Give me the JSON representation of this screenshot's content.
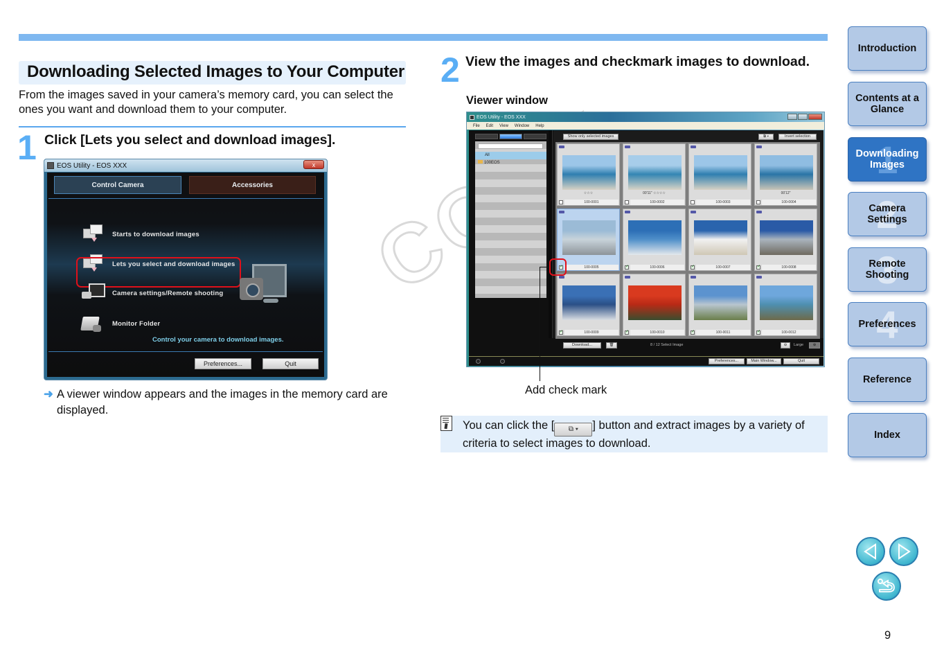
{
  "page": {
    "section_title": "Downloading Selected Images to Your Computer",
    "intro": "From the images saved in your camera’s memory card, you can select the ones you want and download them to your computer.",
    "page_number": "9",
    "watermark": "COPY"
  },
  "step1": {
    "number": "1",
    "title": "Click [Lets you select and download images].",
    "result_arrow": "➜",
    "result_text": "A viewer window appears and the images in the memory card are displayed."
  },
  "eos_main_window": {
    "title": "EOS Utility - EOS XXX",
    "close": "x",
    "tabs": [
      "Control Camera",
      "Accessories"
    ],
    "items": [
      "Starts to download images",
      "Lets you select and download images",
      "Camera settings/Remote shooting",
      "Monitor Folder"
    ],
    "hint": "Control your camera to download images.",
    "buttons": {
      "preferences": "Preferences...",
      "quit": "Quit"
    }
  },
  "step2": {
    "number": "2",
    "title": "View the images and checkmark images to download.",
    "viewer_label": "Viewer window",
    "callout": "Add check mark"
  },
  "viewer_window": {
    "title": "EOS Utility - EOS XXX",
    "menu": [
      "File",
      "Edit",
      "View",
      "Window",
      "Help"
    ],
    "tree": {
      "all": "All",
      "folder": "100EOS"
    },
    "toolbar": {
      "show_selected": "Show only selected images",
      "filter": "⧉ ▾",
      "invert": "Invert selection"
    },
    "thumbnails": [
      {
        "name": "100-0001",
        "meta": "☆☆☆",
        "checked": false,
        "selected": false,
        "colors": [
          "#9cc6e8",
          "#2f7fb0",
          "#d7d2c4"
        ]
      },
      {
        "name": "100-0002",
        "meta": "00'11\" ☆☆☆☆",
        "checked": false,
        "selected": false,
        "colors": [
          "#a7cdea",
          "#3486b3",
          "#d9d4c6"
        ]
      },
      {
        "name": "100-0003",
        "meta": "",
        "checked": false,
        "selected": false,
        "colors": [
          "#9cc6e8",
          "#2f7fb0",
          "#d7d2c4"
        ]
      },
      {
        "name": "100-0004",
        "meta": "00'12\"",
        "checked": false,
        "selected": false,
        "colors": [
          "#8fbde2",
          "#2a75a6",
          "#c9c4b6"
        ]
      },
      {
        "name": "100-0005",
        "meta": "",
        "checked": true,
        "selected": true,
        "colors": [
          "#9bbbd6",
          "#c8d3da",
          "#8d949a"
        ]
      },
      {
        "name": "100-0006",
        "meta": "",
        "checked": true,
        "selected": false,
        "colors": [
          "#2d6fb6",
          "#4f8fc9",
          "#e4e8ec"
        ]
      },
      {
        "name": "100-0007",
        "meta": "",
        "checked": true,
        "selected": false,
        "colors": [
          "#2a64ad",
          "#f1f1f1",
          "#cfc7b5"
        ]
      },
      {
        "name": "100-0008",
        "meta": "",
        "checked": true,
        "selected": false,
        "colors": [
          "#2a5aa6",
          "#a9b3bd",
          "#6f6a60"
        ]
      },
      {
        "name": "100-0009",
        "meta": "",
        "checked": true,
        "selected": false,
        "colors": [
          "#3a70b5",
          "#2b4f86",
          "#d9dde2"
        ]
      },
      {
        "name": "100-0010",
        "meta": "",
        "checked": true,
        "selected": false,
        "colors": [
          "#d93a1f",
          "#b82a16",
          "#3a4d2e"
        ]
      },
      {
        "name": "100-0011",
        "meta": "",
        "checked": true,
        "selected": false,
        "colors": [
          "#5c93cf",
          "#b8c5cf",
          "#6a7e4a"
        ]
      },
      {
        "name": "100-0012",
        "meta": "",
        "checked": true,
        "selected": false,
        "colors": [
          "#6ea7dc",
          "#4e8fb0",
          "#6d6a4a"
        ]
      }
    ],
    "status": {
      "download": "Download...",
      "trash": "🗑",
      "count": "8 / 12 Select Image",
      "zoom_out": "⊖",
      "size": "Large",
      "zoom_in": "⊕"
    },
    "footer": {
      "preferences": "Preferences...",
      "main_window": "Main Window...",
      "quit": "Quit"
    }
  },
  "tip": {
    "before": "You can click the [",
    "button_glyph": "⧉ ▾",
    "after": "] button and extract images by a variety of criteria to select images to download."
  },
  "nav": [
    {
      "label": "Introduction",
      "num": "",
      "active": false
    },
    {
      "label": "Contents at a Glance",
      "num": "",
      "active": false
    },
    {
      "label": "Downloading Images",
      "num": "1",
      "active": true
    },
    {
      "label": "Camera Settings",
      "num": "2",
      "active": false
    },
    {
      "label": "Remote Shooting",
      "num": "3",
      "active": false
    },
    {
      "label": "Preferences",
      "num": "4",
      "active": false
    },
    {
      "label": "Reference",
      "num": "",
      "active": false
    },
    {
      "label": "Index",
      "num": "",
      "active": false
    }
  ],
  "pager": {
    "prev": "previous-page",
    "next": "next-page",
    "back": "return"
  },
  "colors": {
    "accent": "#5aaef5",
    "nav_bg": "#b3c9e6",
    "nav_active": "#2f74c4",
    "highlight": "#e0101a",
    "tip_bg": "#e3effb"
  }
}
